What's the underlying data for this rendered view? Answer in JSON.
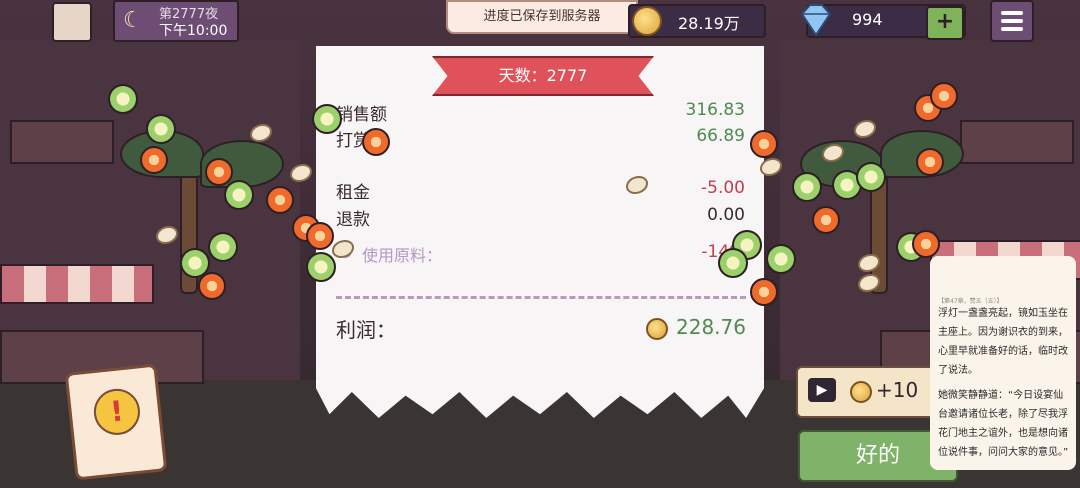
{
  "top_bar": {
    "night_title": "第2777夜",
    "time": "下午10:00",
    "toast": "进度已保存到服务器",
    "coins": "28.19万",
    "gems": "994",
    "plus_label": "+"
  },
  "receipt": {
    "banner": "天数：2777",
    "rows": [
      {
        "label": "销售额",
        "value": "316.83"
      },
      {
        "label": "打赏",
        "value": "66.89"
      },
      {
        "label": "租金",
        "value": "-5.00"
      },
      {
        "label": "退款",
        "value": "0.00"
      }
    ],
    "materials_label": "使用原料：",
    "materials_value": "-149",
    "profit_label": "利润：",
    "profit_value": "228.76"
  },
  "ad_reward": {
    "value": "+10"
  },
  "ok_button": "好的",
  "alert_icon_label": "!",
  "reader": {
    "header": "【第47章，赞五（五）】",
    "p1": "浮灯一盏盏亮起，镜如玉坐在主座上。因为谢识衣的到来，心里早就准备好的话，临时改了说法。",
    "p2": "她微笑静静道：“今日设宴仙台邀请诸位长老，除了尽我浮花门地主之谊外，也是想向诸位说件事，问问大家的意见。”"
  },
  "colors": {
    "positive": "#4f8a4f",
    "negative": "#c0404f",
    "banner": "#e0525a",
    "ok_button": "#7fb36a"
  }
}
